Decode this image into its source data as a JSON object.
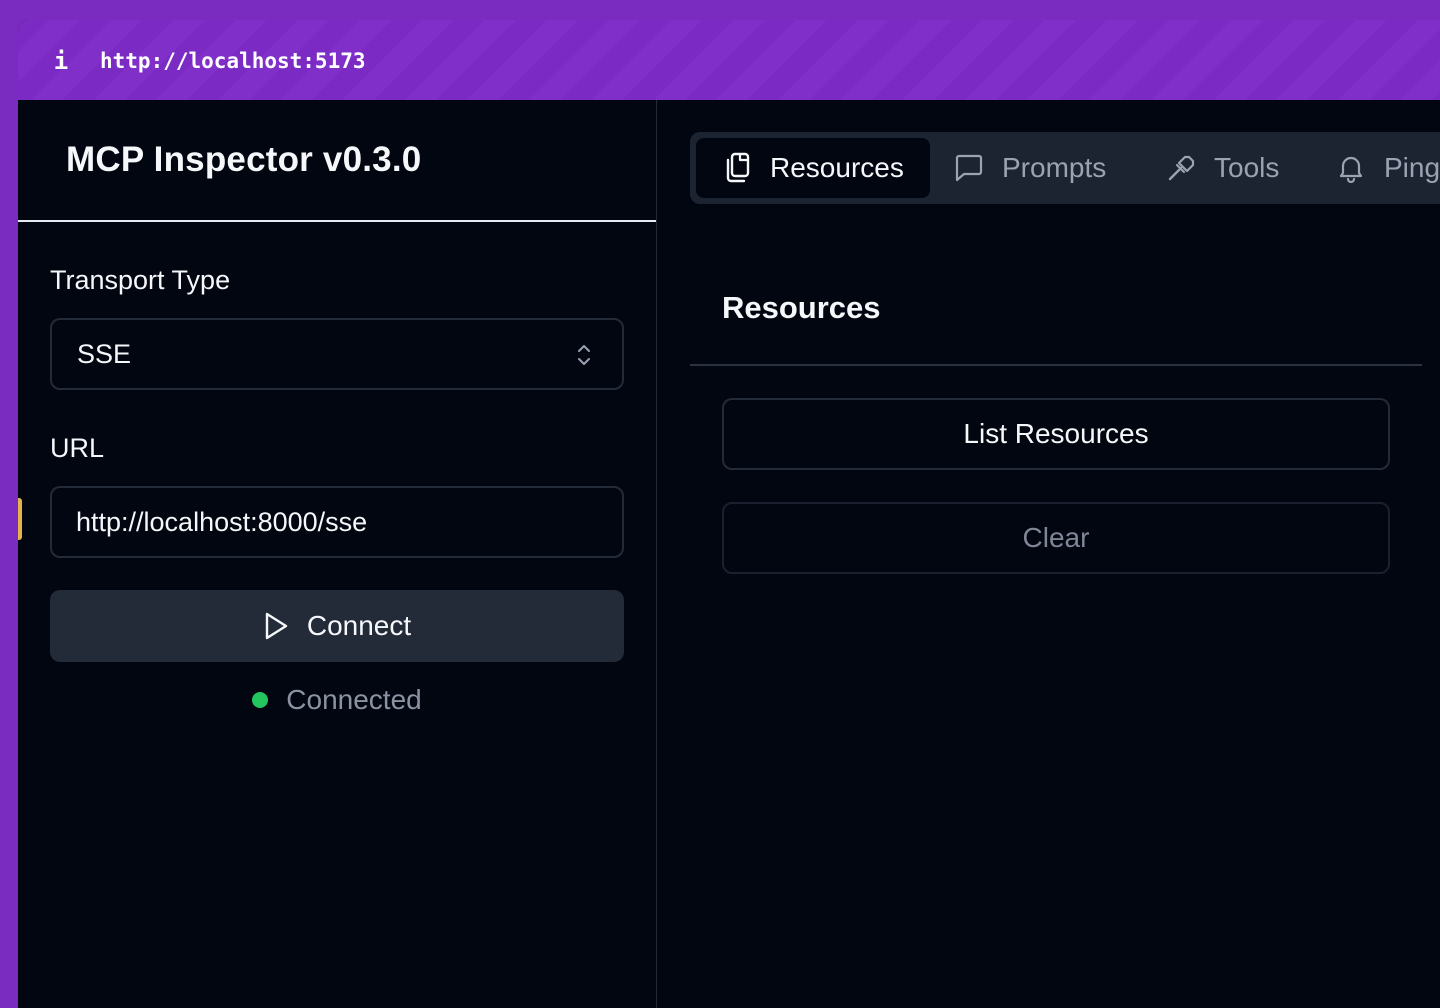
{
  "browser": {
    "url": "http://localhost:5173",
    "info_icon": "info-icon"
  },
  "sidebar": {
    "title": "MCP Inspector v0.3.0",
    "transport_label": "Transport Type",
    "transport_value": "SSE",
    "url_label": "URL",
    "url_value": "http://localhost:8000/sse",
    "connect_label": "Connect",
    "connect_icon": "play-icon",
    "status_text": "Connected",
    "status_color": "#22c55e"
  },
  "tabs": [
    {
      "label": "Resources",
      "icon": "copy-icon",
      "active": true
    },
    {
      "label": "Prompts",
      "icon": "message-square-icon",
      "active": false
    },
    {
      "label": "Tools",
      "icon": "hammer-icon",
      "active": false
    },
    {
      "label": "Ping",
      "icon": "bell-icon",
      "active": false
    }
  ],
  "main": {
    "section_title": "Resources",
    "list_button": "List Resources",
    "clear_button": "Clear"
  },
  "colors": {
    "accent_purple": "#7c2ac4",
    "background": "#020611",
    "panel": "#232a38"
  }
}
